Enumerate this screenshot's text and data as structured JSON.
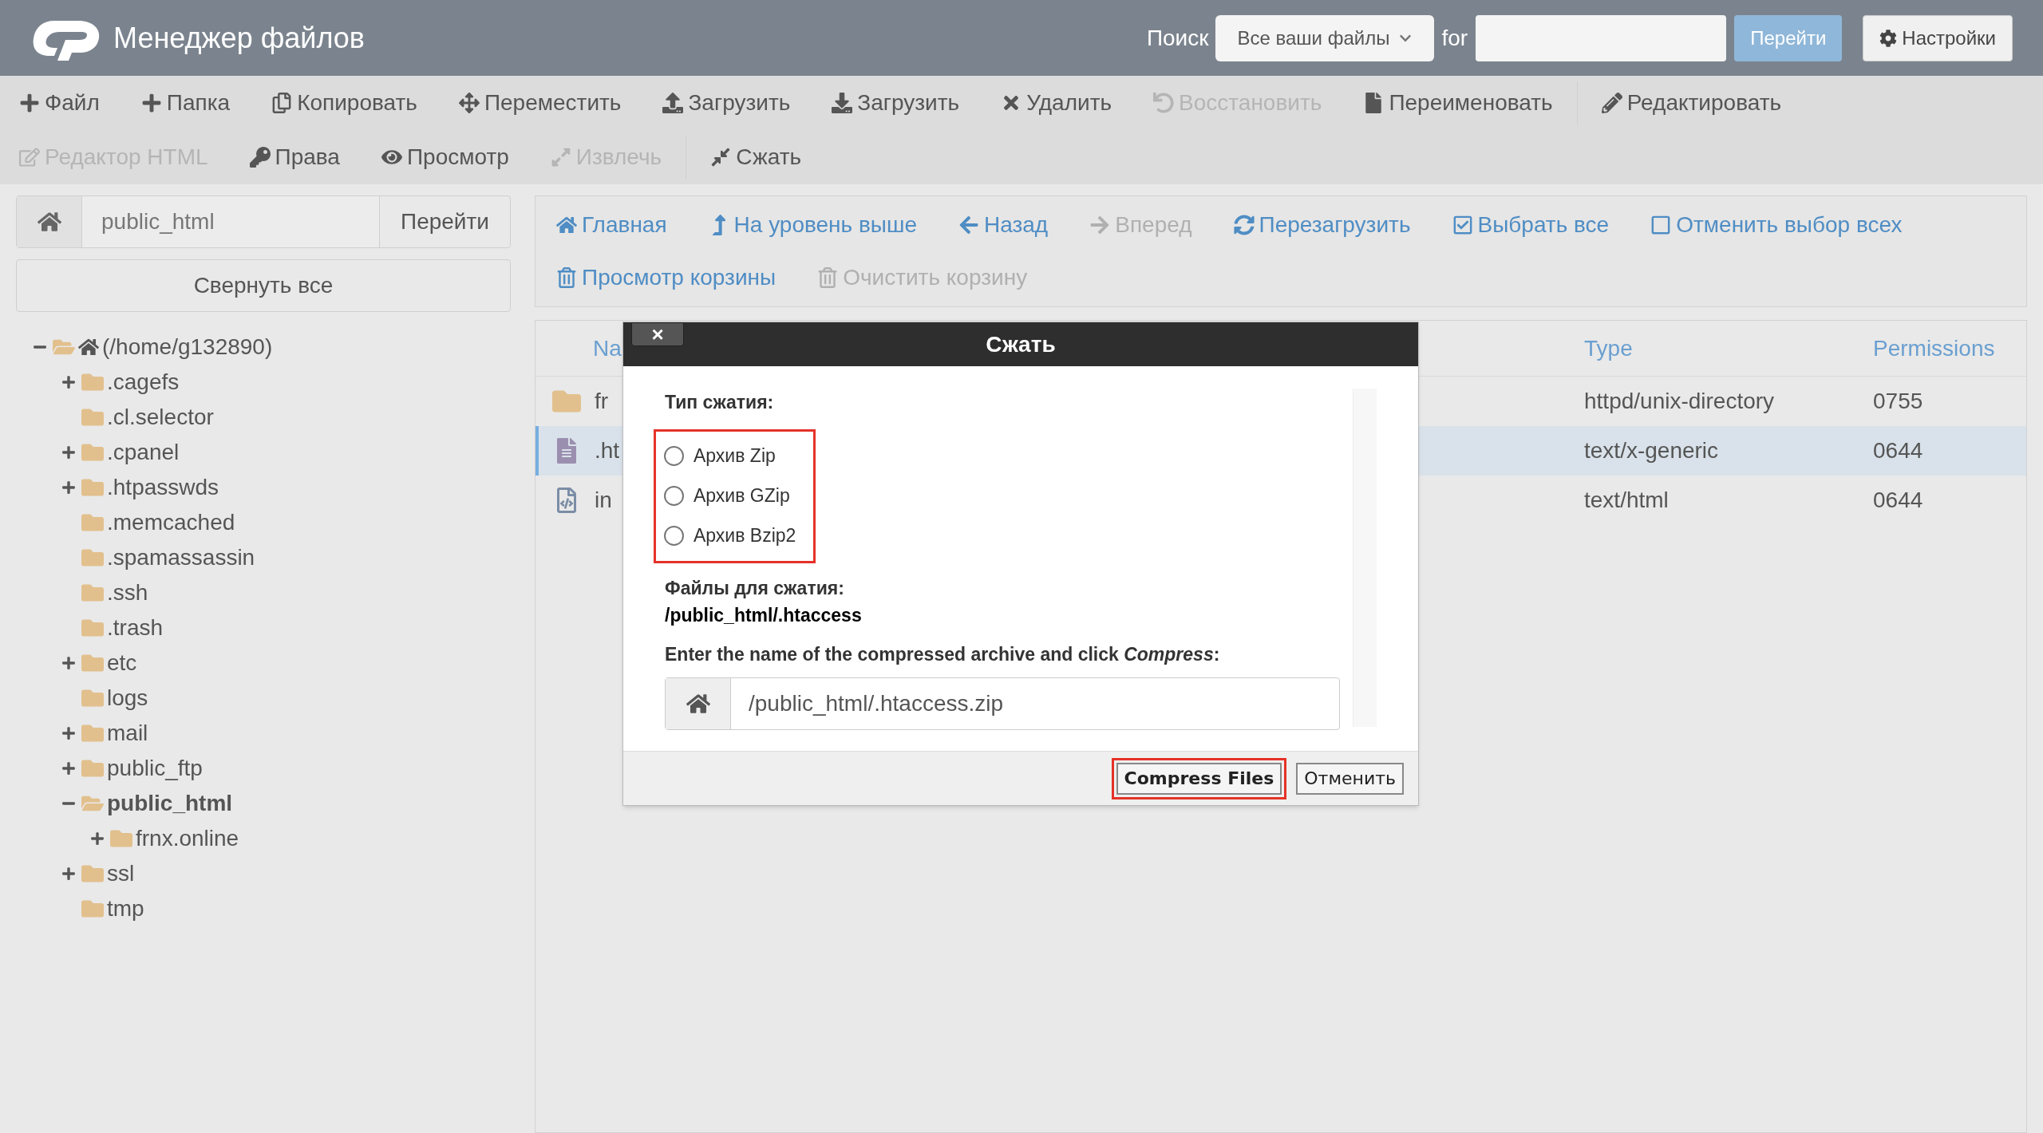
{
  "header": {
    "title": "Менеджер файлов",
    "search_label": "Поиск",
    "scope": "Все ваши файлы",
    "for_label": "for",
    "go_button": "Перейти",
    "settings_button": "Настройки"
  },
  "toolbar": [
    [
      {
        "label": "Файл",
        "disabled": false
      },
      {
        "label": "Папка",
        "disabled": false
      },
      {
        "label": "Копировать",
        "disabled": false
      },
      {
        "label": "Переместить",
        "disabled": false
      },
      {
        "label": "Загрузить",
        "disabled": false
      },
      {
        "label": "Загрузить",
        "disabled": false
      },
      {
        "label": "Удалить",
        "disabled": false
      },
      {
        "label": "Восстановить",
        "disabled": true
      },
      {
        "label": "Переименовать",
        "disabled": false
      },
      {
        "label": "Редактировать",
        "disabled": false
      }
    ],
    [
      {
        "label": "Редактор HTML",
        "disabled": true
      },
      {
        "label": "Права",
        "disabled": false
      },
      {
        "label": "Просмотр",
        "disabled": false
      },
      {
        "label": "Извлечь",
        "disabled": true
      },
      {
        "label": "Сжать",
        "disabled": false
      }
    ]
  ],
  "sidebar": {
    "path_value": "public_html",
    "go_button": "Перейти",
    "collapse_button": "Свернуть все",
    "tree": [
      {
        "label": "(/home/g132890)",
        "expandable": true,
        "expanded": true,
        "selected": false,
        "children": [
          {
            "label": ".cagefs",
            "expandable": true,
            "expanded": false,
            "selected": false
          },
          {
            "label": ".cl.selector",
            "expandable": false,
            "expanded": false,
            "selected": false
          },
          {
            "label": ".cpanel",
            "expandable": true,
            "expanded": false,
            "selected": false
          },
          {
            "label": ".htpasswds",
            "expandable": true,
            "expanded": false,
            "selected": false
          },
          {
            "label": ".memcached",
            "expandable": false,
            "expanded": false,
            "selected": false
          },
          {
            "label": ".spamassassin",
            "expandable": false,
            "expanded": false,
            "selected": false
          },
          {
            "label": ".ssh",
            "expandable": false,
            "expanded": false,
            "selected": false
          },
          {
            "label": ".trash",
            "expandable": false,
            "expanded": false,
            "selected": false
          },
          {
            "label": "etc",
            "expandable": true,
            "expanded": false,
            "selected": false
          },
          {
            "label": "logs",
            "expandable": false,
            "expanded": false,
            "selected": false
          },
          {
            "label": "mail",
            "expandable": true,
            "expanded": false,
            "selected": false
          },
          {
            "label": "public_ftp",
            "expandable": true,
            "expanded": false,
            "selected": false
          },
          {
            "label": "public_html",
            "expandable": true,
            "expanded": true,
            "selected": true,
            "children": [
              {
                "label": "frnx.online",
                "expandable": true,
                "expanded": false,
                "selected": false
              }
            ]
          },
          {
            "label": "ssl",
            "expandable": true,
            "expanded": false,
            "selected": false
          },
          {
            "label": "tmp",
            "expandable": false,
            "expanded": false,
            "selected": false
          }
        ]
      }
    ]
  },
  "nav": [
    [
      {
        "label": "Главная",
        "disabled": false
      },
      {
        "label": "На уровень выше",
        "disabled": false
      },
      {
        "label": "Назад",
        "disabled": false
      },
      {
        "label": "Вперед",
        "disabled": true
      },
      {
        "label": "Перезагрузить",
        "disabled": false
      },
      {
        "label": "Выбрать все",
        "disabled": false
      },
      {
        "label": "Отменить выбор всех",
        "disabled": false
      }
    ],
    [
      {
        "label": "Просмотр корзины",
        "disabled": false
      },
      {
        "label": "Очистить корзину",
        "disabled": true
      }
    ]
  ],
  "table": {
    "columns": [
      "Na",
      "Type",
      "Permissions"
    ],
    "rows": [
      {
        "kind": "folder",
        "name": "fr",
        "type": "httpd/unix-directory",
        "permissions": "0755",
        "selected": false
      },
      {
        "kind": "text",
        "name": ".ht",
        "type": "text/x-generic",
        "permissions": "0644",
        "selected": true
      },
      {
        "kind": "html",
        "name": "in",
        "type": "text/html",
        "permissions": "0644",
        "selected": false
      }
    ]
  },
  "dialog": {
    "title": "Сжать",
    "close": "×",
    "type_label": "Тип сжатия:",
    "options_highlighted": true,
    "options": [
      {
        "label": "Архив Zip",
        "selected": false
      },
      {
        "label": "Архив GZip",
        "selected": false
      },
      {
        "label": "Архив Bzip2",
        "selected": false
      }
    ],
    "files_label": "Файлы для сжатия:",
    "files_value": "/public_html/.htaccess",
    "prompt": "Enter the name of the compressed archive and click *Compress*:",
    "archive_value": "/public_html/.htaccess.zip",
    "buttons": [
      {
        "label": "Compress Files",
        "kind": "primary",
        "highlighted": true
      },
      {
        "label": "Отменить",
        "kind": "cancel",
        "highlighted": false
      }
    ]
  }
}
